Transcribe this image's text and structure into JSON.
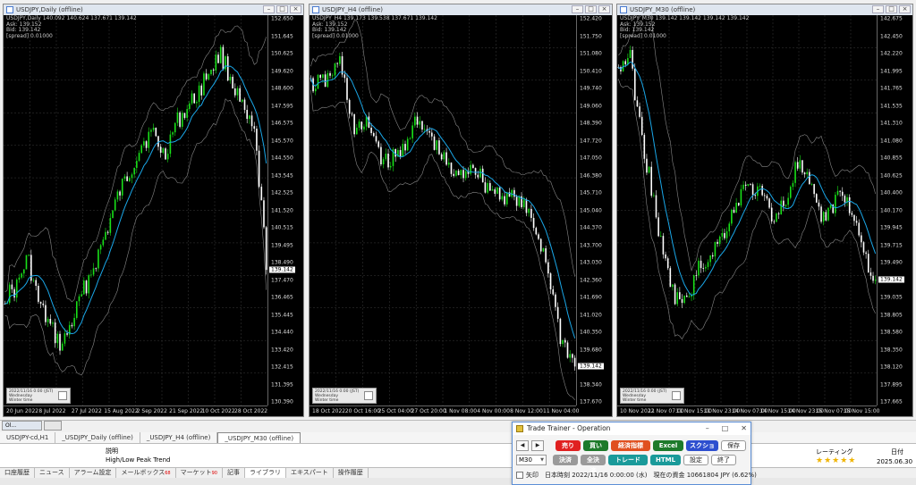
{
  "colors": {
    "bg": "#000000",
    "bull": "#18e018",
    "bear": "#ffffff",
    "ma": "#1aa7e8",
    "band": "#888888"
  },
  "charts": [
    {
      "title": "USDJPY,Daily (offline)",
      "info": "USDJPY,Daily 140.092 140.624 137.671 139.142\nAsk: 139.152\nBid: 139.142\n[spread] 0.01000",
      "mini": "2022/11/16 0:00 (JST)\nWednesday\nWinter time",
      "yticks": [
        "152.650",
        "151.645",
        "150.625",
        "149.620",
        "148.600",
        "147.595",
        "146.575",
        "145.570",
        "144.550",
        "143.545",
        "142.525",
        "141.520",
        "140.515",
        "139.495",
        "138.490",
        "137.470",
        "136.465",
        "135.445",
        "134.440",
        "133.420",
        "132.415",
        "131.395",
        "130.390"
      ],
      "current": "139.142",
      "xticks": [
        "20 Jun 2022",
        "8 Jul 2022",
        "27 Jul 2022",
        "15 Aug 2022",
        "2 Sep 2022",
        "21 Sep 2022",
        "10 Oct 2022",
        "28 Oct 2022"
      ]
    },
    {
      "title": "USDJPY_H4 (offline)",
      "info": "USDJPY_H4 139.173 139.538 137.671 139.142\nAsk: 139.152\nBid: 139.142\n[spread] 0.01000",
      "mini": "2022/11/16 0:00 (JST)\nWednesday\nWinter time",
      "yticks": [
        "152.420",
        "151.750",
        "151.080",
        "150.410",
        "149.740",
        "149.060",
        "148.390",
        "147.720",
        "147.050",
        "146.380",
        "145.710",
        "145.040",
        "144.370",
        "143.700",
        "143.030",
        "142.360",
        "141.690",
        "141.020",
        "140.350",
        "139.680",
        "139.010",
        "138.340",
        "137.670"
      ],
      "current": "139.142",
      "xticks": [
        "18 Oct 2022",
        "20 Oct 16:00",
        "25 Oct 04:00",
        "27 Oct 20:00",
        "1 Nov 08:00",
        "4 Nov 00:00",
        "8 Nov 12:00",
        "11 Nov 04:00"
      ]
    },
    {
      "title": "USDJPY_M30 (offline)",
      "info": "USDJPY_M30 139.142 139.142 139.142 139.142\nAsk: 139.152\nBid: 139.142\n[spread] 0.01000",
      "mini": "2022/11/16 0:00 (JST)\nWednesday\nWinter time",
      "yticks": [
        "142.675",
        "142.450",
        "142.220",
        "141.995",
        "141.765",
        "141.535",
        "141.310",
        "141.080",
        "140.855",
        "140.625",
        "140.400",
        "140.170",
        "139.945",
        "139.715",
        "139.490",
        "139.260",
        "139.035",
        "138.805",
        "138.580",
        "138.350",
        "138.120",
        "137.895",
        "137.665"
      ],
      "current": "139.142",
      "xticks": [
        "10 Nov 2022",
        "11 Nov 07:00",
        "11 Nov 15:00",
        "11 Nov 23:00",
        "14 Nov 07:00",
        "14 Nov 15:00",
        "14 Nov 23:00",
        "15 Nov 07:00",
        "15 Nov 15:00"
      ]
    }
  ],
  "mini_win_label": "Ol...",
  "chart_tabs": [
    "USDJPY-cd,H1",
    "_USDJPY_Daily (offline)",
    "_USDJPY_H4 (offline)",
    "_USDJPY_M30 (offline)"
  ],
  "terminal": {
    "desc_header": "説明",
    "desc_value": "High/Low Peak Trend",
    "rating_header": "レーティング",
    "rating_stars": "★★★★★",
    "date_header": "日付",
    "date_value": "2025.06.30"
  },
  "terminal_tabs": [
    {
      "label": "口座履歴",
      "count": ""
    },
    {
      "label": "ニュース",
      "count": ""
    },
    {
      "label": "アラーム設定",
      "count": ""
    },
    {
      "label": "メールボックス",
      "count": "68"
    },
    {
      "label": "マーケット",
      "count": "90"
    },
    {
      "label": "記事",
      "count": ""
    },
    {
      "label": "ライブラリ",
      "count": ""
    },
    {
      "label": "エキスパート",
      "count": ""
    },
    {
      "label": "操作履歴",
      "count": ""
    }
  ],
  "trainer": {
    "title": "Trade Trainer - Operation",
    "prev": "◀",
    "next": "▶",
    "sell": "売り",
    "buy": "買い",
    "indicator": "経済指標",
    "excel": "Excel",
    "screenshot": "スクショ",
    "save": "保存",
    "timeframe": "M30",
    "settle": "決済",
    "settle_all": "全決済",
    "trade": "トレード",
    "html": "HTML",
    "settings": "設定",
    "exit": "終了",
    "arrow_label": "矢印",
    "status": "日本時刻 2022/11/16 0:00:00 (水)　現在の資金 10661804 JPY (6.62%)"
  }
}
